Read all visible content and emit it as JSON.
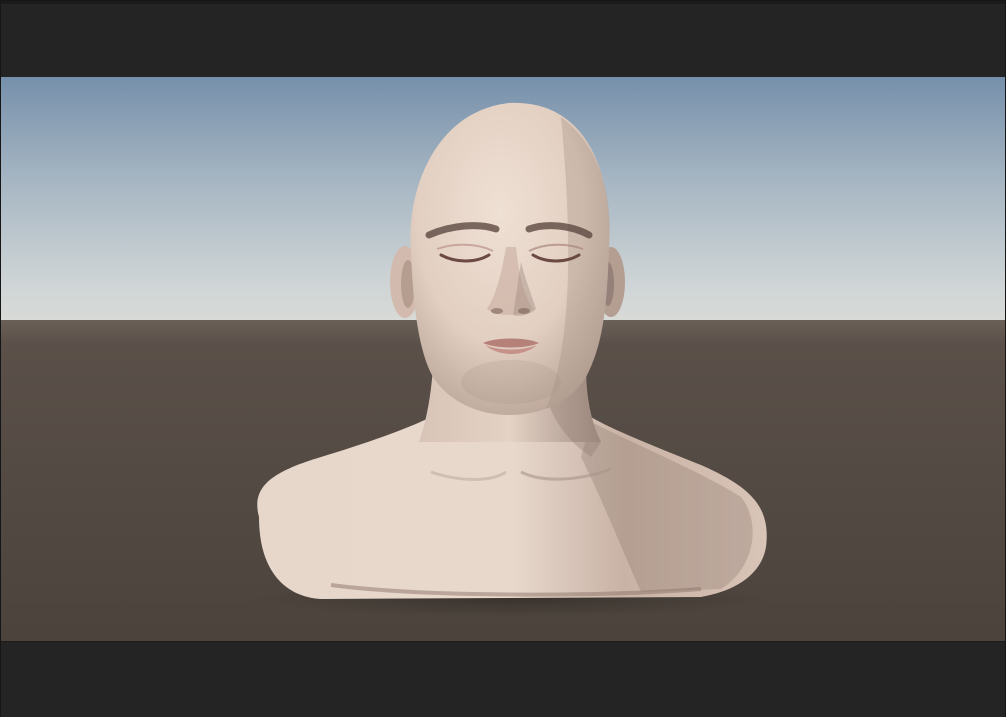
{
  "scene": {
    "description_free": true,
    "sky_colors": {
      "top": "#7892ad",
      "mid": "#b6c3cc",
      "horizon": "#d5d8d6"
    },
    "ground_colors": {
      "near_horizon": "#5f554d",
      "far": "#4d443d"
    },
    "skin_color": "#e6d3c6",
    "letterbox_color": "#242424"
  }
}
